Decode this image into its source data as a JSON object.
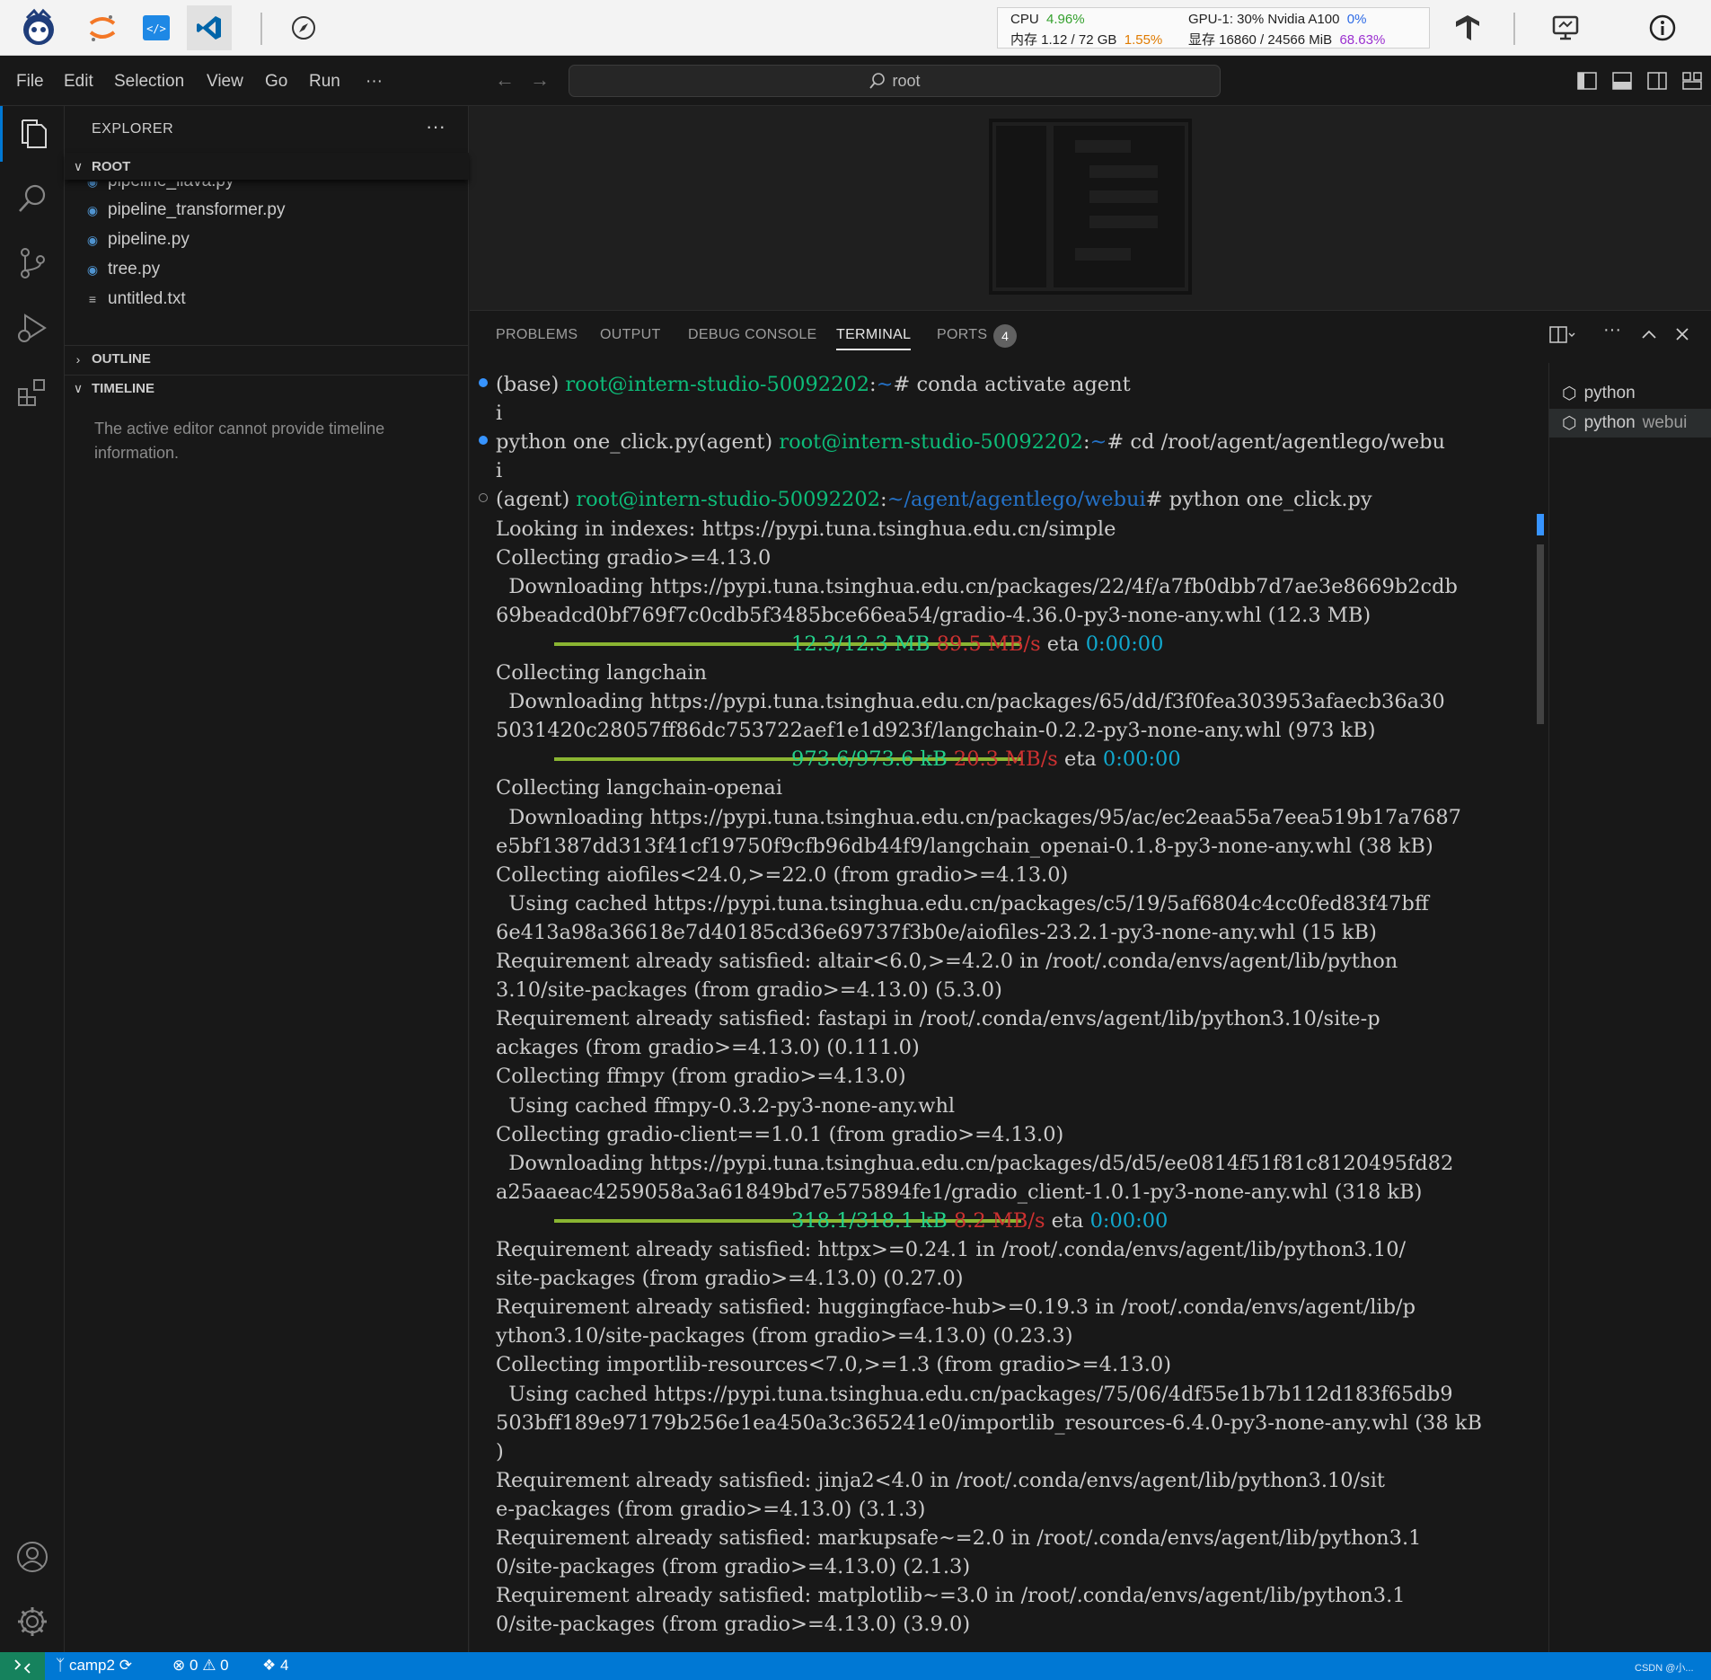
{
  "system_monitor": {
    "cpu_label": "CPU",
    "cpu_value": "4.96%",
    "mem_label": "内存 1.12 / 72 GB",
    "mem_value": "1.55%",
    "gpu_label": "GPU-1: 30% Nvidia A100",
    "gpu_value": "0%",
    "vram_label": "显存 16860 / 24566 MiB",
    "vram_value": "68.63%"
  },
  "menu": [
    "File",
    "Edit",
    "Selection",
    "View",
    "Go",
    "Run",
    "···"
  ],
  "search": {
    "text": "root"
  },
  "sidebar": {
    "title": "EXPLORER",
    "more": "···",
    "root_label": "ROOT",
    "files": [
      {
        "name": "pipeline_llava.py",
        "type": "py"
      },
      {
        "name": "pipeline_transformer.py",
        "type": "py"
      },
      {
        "name": "pipeline.py",
        "type": "py"
      },
      {
        "name": "tree.py",
        "type": "py"
      },
      {
        "name": "untitled.txt",
        "type": "txt"
      }
    ],
    "outline_label": "OUTLINE",
    "timeline_label": "TIMELINE",
    "timeline_message": "The active editor cannot provide timeline information."
  },
  "panel": {
    "tabs": [
      "PROBLEMS",
      "OUTPUT",
      "DEBUG CONSOLE",
      "TERMINAL",
      "PORTS"
    ],
    "active_tab": "TERMINAL",
    "ports_count": "4"
  },
  "terminal": {
    "lines": [
      [
        [
          "(base) ",
          ""
        ],
        [
          "root@intern-studio-50092202",
          "green"
        ],
        [
          ":",
          ""
        ],
        [
          "~",
          "blue"
        ],
        [
          "# conda activate agent",
          ""
        ]
      ],
      [
        [
          "i",
          ""
        ]
      ],
      [
        [
          "python one_click.py(agent) ",
          ""
        ],
        [
          "root@intern-studio-50092202",
          "green"
        ],
        [
          ":",
          ""
        ],
        [
          "~",
          "blue"
        ],
        [
          "# cd /root/agent/agentlego/webu",
          ""
        ]
      ],
      [
        [
          "i",
          ""
        ]
      ],
      [
        [
          "(agent) ",
          ""
        ],
        [
          "root@intern-studio-50092202",
          "green"
        ],
        [
          ":",
          ""
        ],
        [
          "~/agent/agentlego/webui",
          "blue"
        ],
        [
          "# python one_click.py",
          ""
        ]
      ],
      [
        [
          "Looking in indexes: https://pypi.tuna.tsinghua.edu.cn/simple",
          ""
        ]
      ],
      [
        [
          "Collecting gradio>=4.13.0",
          ""
        ]
      ],
      [
        [
          "  Downloading https://pypi.tuna.tsinghua.edu.cn/packages/22/4f/a7fb0dbb7d7ae3e8669b2cdb",
          ""
        ]
      ],
      [
        [
          "69beadcd0bf769f7c0cdb5f3485bce66ea54/gradio-4.36.0-py3-none-any.whl (12.3 MB)",
          ""
        ]
      ],
      [
        [
          "PBAR",
          ""
        ],
        [
          "12.3/12.3 MB",
          "bargreen"
        ],
        [
          " ",
          ""
        ],
        [
          "89.5 MB/s",
          "red"
        ],
        [
          " eta ",
          ""
        ],
        [
          "0:00:00",
          "cyan"
        ]
      ],
      [
        [
          "Collecting langchain",
          ""
        ]
      ],
      [
        [
          "  Downloading https://pypi.tuna.tsinghua.edu.cn/packages/65/dd/f3f0fea303953afaecb36a30",
          ""
        ]
      ],
      [
        [
          "5031420c28057ff86dc753722aef1e1d923f/langchain-0.2.2-py3-none-any.whl (973 kB)",
          ""
        ]
      ],
      [
        [
          "PBAR",
          ""
        ],
        [
          "973.6/973.6 kB",
          "bargreen"
        ],
        [
          " ",
          ""
        ],
        [
          "20.3 MB/s",
          "red"
        ],
        [
          " eta ",
          ""
        ],
        [
          "0:00:00",
          "cyan"
        ]
      ],
      [
        [
          "Collecting langchain-openai",
          ""
        ]
      ],
      [
        [
          "  Downloading https://pypi.tuna.tsinghua.edu.cn/packages/95/ac/ec2eaa55a7eea519b17a7687",
          ""
        ]
      ],
      [
        [
          "e5bf1387dd313f41cf19750f9cfb96db44f9/langchain_openai-0.1.8-py3-none-any.whl (38 kB)",
          ""
        ]
      ],
      [
        [
          "Collecting aiofiles<24.0,>=22.0 (from gradio>=4.13.0)",
          ""
        ]
      ],
      [
        [
          "  Using cached https://pypi.tuna.tsinghua.edu.cn/packages/c5/19/5af6804c4cc0fed83f47bff",
          ""
        ]
      ],
      [
        [
          "6e413a98a36618e7d40185cd36e69737f3b0e/aiofiles-23.2.1-py3-none-any.whl (15 kB)",
          ""
        ]
      ],
      [
        [
          "Requirement already satisfied: altair<6.0,>=4.2.0 in /root/.conda/envs/agent/lib/python",
          ""
        ]
      ],
      [
        [
          "3.10/site-packages (from gradio>=4.13.0) (5.3.0)",
          ""
        ]
      ],
      [
        [
          "Requirement already satisfied: fastapi in /root/.conda/envs/agent/lib/python3.10/site-p",
          ""
        ]
      ],
      [
        [
          "ackages (from gradio>=4.13.0) (0.111.0)",
          ""
        ]
      ],
      [
        [
          "Collecting ffmpy (from gradio>=4.13.0)",
          ""
        ]
      ],
      [
        [
          "  Using cached ffmpy-0.3.2-py3-none-any.whl",
          ""
        ]
      ],
      [
        [
          "Collecting gradio-client==1.0.1 (from gradio>=4.13.0)",
          ""
        ]
      ],
      [
        [
          "  Downloading https://pypi.tuna.tsinghua.edu.cn/packages/d5/d5/ee0814f51f81c8120495fd82",
          ""
        ]
      ],
      [
        [
          "a25aaeac4259058a3a61849bd7e575894fe1/gradio_client-1.0.1-py3-none-any.whl (318 kB)",
          ""
        ]
      ],
      [
        [
          "PBAR",
          ""
        ],
        [
          "318.1/318.1 kB",
          "bargreen"
        ],
        [
          " ",
          ""
        ],
        [
          "8.2 MB/s",
          "red"
        ],
        [
          " eta ",
          ""
        ],
        [
          "0:00:00",
          "cyan"
        ]
      ],
      [
        [
          "Requirement already satisfied: httpx>=0.24.1 in /root/.conda/envs/agent/lib/python3.10/",
          ""
        ]
      ],
      [
        [
          "site-packages (from gradio>=4.13.0) (0.27.0)",
          ""
        ]
      ],
      [
        [
          "Requirement already satisfied: huggingface-hub>=0.19.3 in /root/.conda/envs/agent/lib/p",
          ""
        ]
      ],
      [
        [
          "ython3.10/site-packages (from gradio>=4.13.0) (0.23.3)",
          ""
        ]
      ],
      [
        [
          "Collecting importlib-resources<7.0,>=1.3 (from gradio>=4.13.0)",
          ""
        ]
      ],
      [
        [
          "  Using cached https://pypi.tuna.tsinghua.edu.cn/packages/75/06/4df55e1b7b112d183f65db9",
          ""
        ]
      ],
      [
        [
          "503bff189e97179b256e1ea450a3c365241e0/importlib_resources-6.4.0-py3-none-any.whl (38 kB",
          ""
        ]
      ],
      [
        [
          ")",
          ""
        ]
      ],
      [
        [
          "Requirement already satisfied: jinja2<4.0 in /root/.conda/envs/agent/lib/python3.10/sit",
          ""
        ]
      ],
      [
        [
          "e-packages (from gradio>=4.13.0) (3.1.3)",
          ""
        ]
      ],
      [
        [
          "Requirement already satisfied: markupsafe~=2.0 in /root/.conda/envs/agent/lib/python3.1",
          ""
        ]
      ],
      [
        [
          "0/site-packages (from gradio>=4.13.0) (2.1.3)",
          ""
        ]
      ],
      [
        [
          "Requirement already satisfied: matplotlib~=3.0 in /root/.conda/envs/agent/lib/python3.1",
          ""
        ]
      ],
      [
        [
          "0/site-packages (from gradio>=4.13.0) (3.9.0)",
          ""
        ]
      ]
    ]
  },
  "terminal_list": [
    {
      "name": "python",
      "sub": ""
    },
    {
      "name": "python",
      "sub": "webui"
    }
  ],
  "statusbar": {
    "branch": "camp2",
    "errors": "0",
    "warnings": "0",
    "ports": "4",
    "watermark": "CSDN @小..."
  },
  "colors": {
    "accent": "#0078d4",
    "terminal_green": "#0dbc79",
    "terminal_blue": "#2472c8",
    "terminal_cyan": "#11a8cd",
    "terminal_red": "#cd3131",
    "progress_bar": "#8ab532"
  }
}
